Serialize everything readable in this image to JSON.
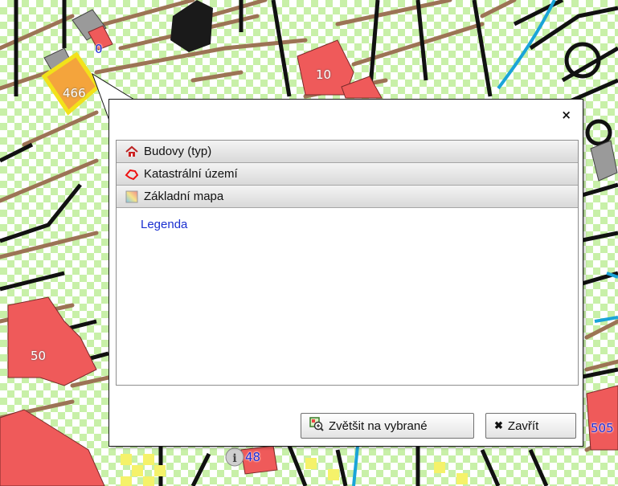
{
  "map": {
    "labels": [
      "0",
      "466",
      "10",
      "50",
      "48",
      "505"
    ]
  },
  "popup": {
    "close_glyph": "×",
    "sections": [
      {
        "label": "Budovy (typ)",
        "icon": "house-icon"
      },
      {
        "label": "Katastrální území",
        "icon": "cadastral-area-icon"
      },
      {
        "label": "Základní mapa",
        "icon": "base-map-icon"
      }
    ],
    "legend_link": "Legenda",
    "buttons": {
      "zoom_label": "Zvětšit na vybrané",
      "close_label": "Zavřít",
      "close_glyph": "✖"
    }
  },
  "colors": {
    "building_fill": "#ef5a5a",
    "selected_building": "#f4a43c",
    "selection_outline": "#f2e21a",
    "stream": "#1aa4d8",
    "parcel_line": "#9c7355",
    "label_text": "#1b2bd8"
  }
}
